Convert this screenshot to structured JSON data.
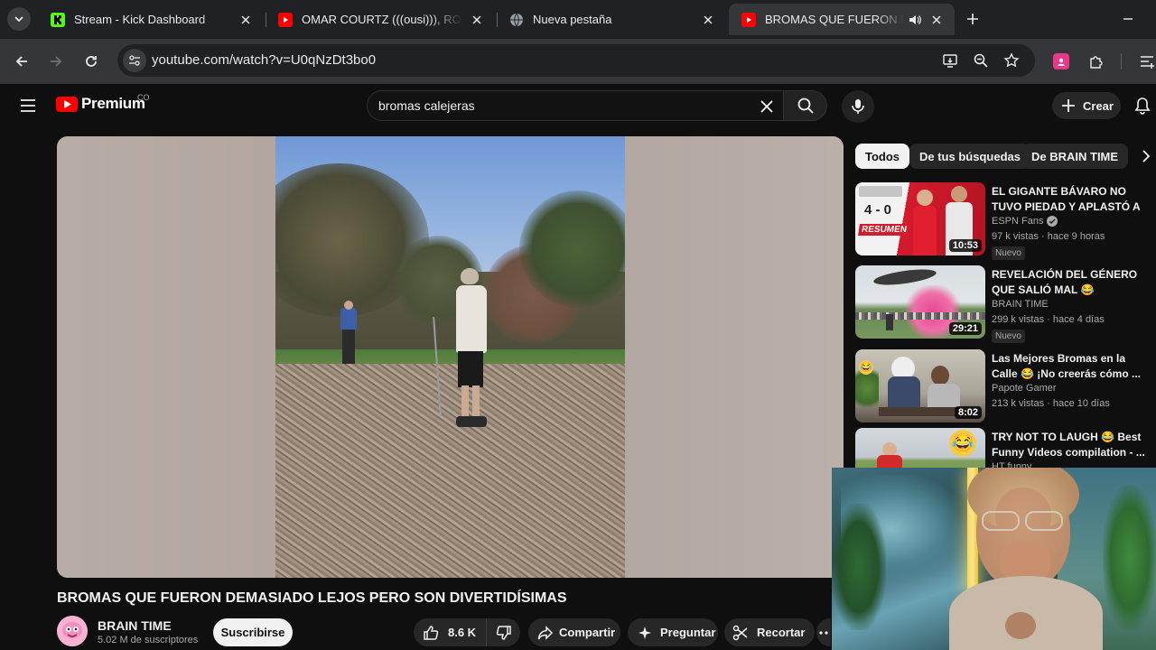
{
  "browser": {
    "tabs": [
      {
        "title": "Stream - Kick Dashboard",
        "favicon": "kick-icon"
      },
      {
        "title": "OMAR COURTZ (((ousi))), ROA - Ojos Chinos",
        "favicon": "youtube-icon"
      },
      {
        "title": "Nueva pestaña",
        "favicon": "globe-icon"
      },
      {
        "title": "BROMAS QUE FUERON DEMASIADO LEJOS",
        "favicon": "youtube-icon",
        "active": true
      }
    ],
    "url": "youtube.com/watch?v=U0qNzDt3bo0"
  },
  "masthead": {
    "logo_text": "Premium",
    "country": "CO",
    "search_query": "bromas calejeras",
    "create_label": "Crear"
  },
  "video": {
    "title": "BROMAS QUE FUERON DEMASIADO LEJOS PERO SON DIVERTIDÍSIMAS",
    "channel": "BRAIN TIME",
    "subscribers": "5.02 M de suscriptores",
    "subscribe_label": "Suscribirse",
    "likes": "8.6 K",
    "share_label": "Compartir",
    "ask_label": "Preguntar",
    "clip_label": "Recortar"
  },
  "chips": [
    "Todos",
    "De tus búsquedas",
    "De BRAIN TIME"
  ],
  "recommendations": [
    {
      "title": "EL GIGANTE BÁVARO NO TUVO PIEDAD Y APLASTÓ A UNION ...",
      "channel": "ESPN Fans",
      "verified": true,
      "meta": "97 k vistas · hace 9 horas",
      "duration": "10:53",
      "badge": "Nuevo",
      "thumb_score": "4 - 0",
      "thumb_word": "RESUMEN"
    },
    {
      "title": "REVELACIÓN DEL GÉNERO QUE SALIÓ MAL 😂 DIVERTIDOS ...",
      "channel": "BRAIN TIME",
      "verified": false,
      "meta": "299 k vistas · hace 4 días",
      "duration": "29:21",
      "badge": "Nuevo"
    },
    {
      "title": "Las Mejores Bromas en la Calle 😂 ¡No creerás cómo ...",
      "channel": "Papote Gamer",
      "verified": false,
      "meta": "213 k vistas · hace 10 días",
      "duration": "8:02",
      "badge": ""
    },
    {
      "title": "TRY NOT TO LAUGH 😂 Best Funny Videos compilation - ...",
      "channel": "HT funny",
      "verified": false,
      "meta": "",
      "duration": "",
      "badge": ""
    }
  ],
  "colors": {
    "accent": "#ff0000",
    "bg": "#0f0f0f",
    "chip": "#272727"
  }
}
